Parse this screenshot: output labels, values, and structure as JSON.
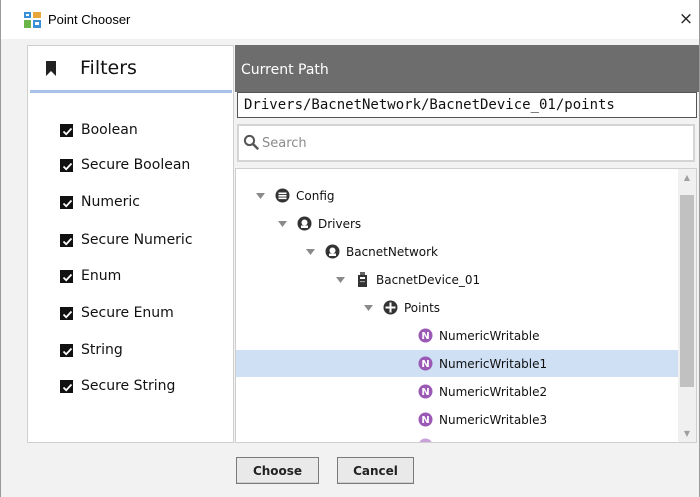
{
  "window": {
    "title": "Point Chooser",
    "close_glyph": "×",
    "app_icon": "tree-grid-icon"
  },
  "filters": {
    "title": "Filters",
    "icon": "bookmark-icon",
    "items": [
      {
        "label": "Boolean",
        "checked": true
      },
      {
        "label": "Secure Boolean",
        "checked": true
      },
      {
        "label": "Numeric",
        "checked": true
      },
      {
        "label": "Secure Numeric",
        "checked": true
      },
      {
        "label": "Enum",
        "checked": true
      },
      {
        "label": "Secure Enum",
        "checked": true
      },
      {
        "label": "String",
        "checked": true
      },
      {
        "label": "Secure String",
        "checked": true
      }
    ]
  },
  "path": {
    "title": "Current Path",
    "value": "Drivers/BacnetNetwork/BacnetDevice_01/points"
  },
  "search": {
    "placeholder": "Search",
    "value": ""
  },
  "tree": {
    "nodes": [
      {
        "label": "Config",
        "icon": "database-icon",
        "expanded": true
      },
      {
        "label": "Drivers",
        "icon": "driver-icon",
        "expanded": true
      },
      {
        "label": "BacnetNetwork",
        "icon": "network-icon",
        "expanded": true
      },
      {
        "label": "BacnetDevice_01",
        "icon": "device-icon",
        "expanded": true
      },
      {
        "label": "Points",
        "icon": "points-icon",
        "expanded": true
      },
      {
        "label": "NumericWritable",
        "icon": "numeric-point-icon"
      },
      {
        "label": "NumericWritable1",
        "icon": "numeric-point-icon",
        "selected": true
      },
      {
        "label": "NumericWritable2",
        "icon": "numeric-point-icon"
      },
      {
        "label": "NumericWritable3",
        "icon": "numeric-point-icon"
      }
    ],
    "point_badge": "N"
  },
  "buttons": {
    "choose": "Choose",
    "cancel": "Cancel"
  },
  "colors": {
    "header_bg": "#6d6d6d",
    "selected_row": "#cfe0f5",
    "filters_accent": "#a6c3e7",
    "point_icon": "#9b59b6"
  }
}
